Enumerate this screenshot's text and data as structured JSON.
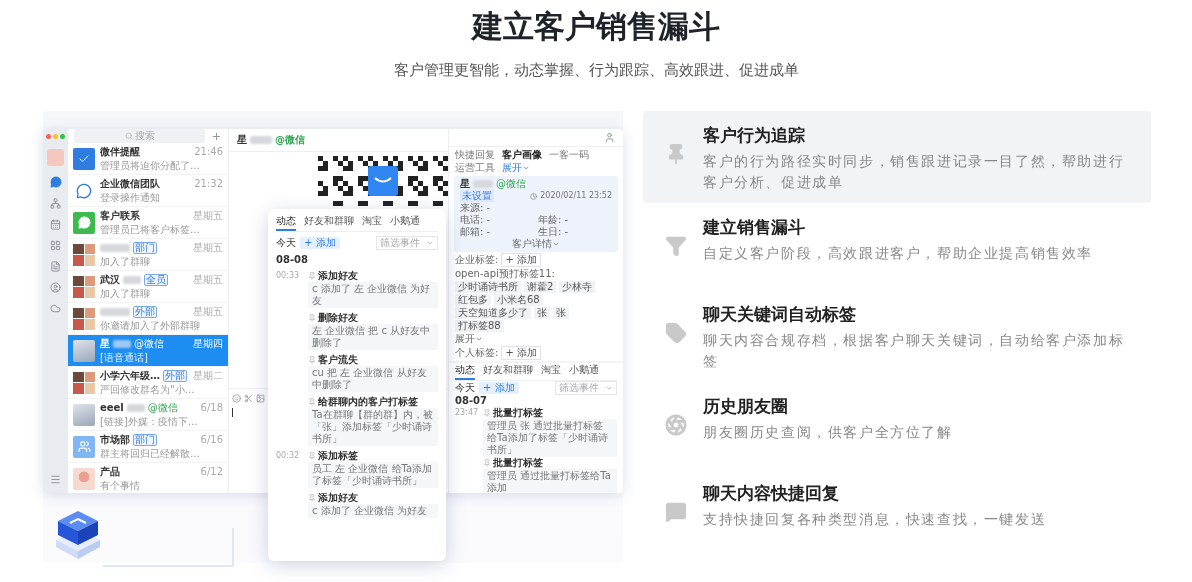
{
  "header": {
    "title": "建立客户销售漏斗",
    "subtitle": "客户管理更智能，动态掌握、行为跟踪、高效跟进、促进成单"
  },
  "app": {
    "search": {
      "placeholder": "搜索"
    },
    "chats": [
      {
        "kind": "remind",
        "name": "微伴提醒",
        "time": "21:46",
        "preview": "管理员将迫你分配了…",
        "selected": false
      },
      {
        "kind": "team",
        "name": "企业微信团队",
        "time": "21:32",
        "preview": "登录操作通知",
        "selected": false
      },
      {
        "kind": "contact",
        "name": "客户联系",
        "time": "星期五",
        "preview": "管理员已将客户标签…",
        "selected": false
      },
      {
        "kind": "group",
        "badge": "部门",
        "time": "星期五",
        "preview": "加入了群聊",
        "selected": false
      },
      {
        "kind": "group",
        "name": "武汉",
        "badge": "全员",
        "time": "星期五",
        "preview": "加入了群聊",
        "selected": false
      },
      {
        "kind": "group",
        "badge": "外部",
        "time": "星期五",
        "preview": "你邀请加入了外部群聊",
        "selected": false
      },
      {
        "kind": "photo",
        "name": "星",
        "tag": "@微信",
        "time": "星期四",
        "preview": "[语音通话]",
        "selected": true
      },
      {
        "kind": "group",
        "name": "小学六年级…",
        "badge": "外部",
        "time": "星期二",
        "preview": "严回修改群名为\"小…",
        "selected": false
      },
      {
        "kind": "photo",
        "name": "eeel",
        "tag": "@微信",
        "time": "6/18",
        "preview": "[链接]外媒：疫情下…",
        "selected": false
      },
      {
        "kind": "dept",
        "name": "市场部",
        "badge": "部门",
        "time": "6/16",
        "preview": "群主将回归已经解散…",
        "selected": false
      },
      {
        "kind": "portrait",
        "name": "产品",
        "time": "6/12",
        "preview": "有个事情",
        "selected": false
      }
    ],
    "conversation": {
      "name": "星",
      "tag": "@微信"
    },
    "profile_panel": {
      "tabs": [
        {
          "label": "快捷回复",
          "selected": false
        },
        {
          "label": "客户画像",
          "selected": true
        },
        {
          "label": "一客一码",
          "selected": false
        },
        {
          "label": "运营工具",
          "selected": false
        }
      ],
      "expand": "展开",
      "customer": {
        "name": "星",
        "tag": "@微信",
        "status": "未设置",
        "time": "2020/02/11 23:52",
        "fields": [
          "来源: -",
          "电话: -",
          "年龄: -",
          "邮箱: -",
          "生日: -"
        ],
        "details": "客户详情"
      },
      "corp_tags_label": "企业标签:",
      "corp_add": "+ 添加",
      "tag_group": "open-api预打标签11:",
      "tags": [
        "少时诵诗书所",
        "谢藿2",
        "少林寺",
        "红包多",
        "小米名68",
        "天空知道多少了",
        "张",
        "张",
        "打标签88"
      ],
      "more": "展开",
      "personal_tags_label": "个人标签:",
      "personal_add": "+ 添加",
      "activity": {
        "tabs": [
          {
            "label": "动态",
            "selected": true
          },
          {
            "label": "好友和群聊",
            "selected": false
          },
          {
            "label": "淘宝",
            "selected": false
          },
          {
            "label": "小鹅通",
            "selected": false
          }
        ],
        "today": "今天",
        "add": "+ 添加",
        "filter": "筛选事件",
        "date": "08-07",
        "events": [
          {
            "time": "23:47",
            "title": "批量打标签",
            "text": "管理员 张 通过批量打标签给Ta添加了标签「少时诵诗书所」"
          },
          {
            "title": "批量打标签",
            "text": "管理员 通过批量打标签给Ta添加"
          }
        ]
      }
    }
  },
  "timeline_popup": {
    "tabs": [
      {
        "label": "动态",
        "selected": true
      },
      {
        "label": "好友和群聊",
        "selected": false
      },
      {
        "label": "淘宝",
        "selected": false
      },
      {
        "label": "小鹅通",
        "selected": false
      }
    ],
    "today": "今天",
    "add": "+ 添加",
    "filter": "筛选事件",
    "date": "08-08",
    "events": [
      {
        "time": "00:33",
        "title": "添加好友",
        "text": "c 添加了 左 企业微信 为好友"
      },
      {
        "title": "删除好友",
        "text": "左 企业微信 把 c 从好友中删除了"
      },
      {
        "title": "客户流失",
        "text": "cu 把 左 企业微信 从好友中删除了"
      },
      {
        "title": "给群聊内的客户打标签",
        "text": "Ta在群聊【群的群】内，被「张」添加标签「少时诵诗书所」"
      },
      {
        "time": "00:32",
        "title": "添加标签",
        "text": "员工 左 企业微信 给Ta添加了标签「少时诵诗书所」"
      },
      {
        "title": "添加好友",
        "text": "c 添加了 企业微信 为好友"
      }
    ]
  },
  "features": [
    {
      "title": "客户行为追踪",
      "desc": "客户的行为路径实时同步，销售跟进记录一目了然，帮助进行客户分析、促进成单",
      "selected": true
    },
    {
      "title": "建立销售漏斗",
      "desc": "自定义客户阶段，高效跟进客户，帮助企业提高销售效率",
      "selected": false
    },
    {
      "title": "聊天关键词自动标签",
      "desc": "聊天内容合规存档，根据客户聊天关键词，自动给客户添加标签",
      "selected": false
    },
    {
      "title": "历史朋友圈",
      "desc": "朋友圈历史查阅，供客户全方位了解",
      "selected": false
    },
    {
      "title": "聊天内容快捷回复",
      "desc": "支持快捷回复各种类型消息，快速查找，一键发送",
      "selected": false
    }
  ]
}
